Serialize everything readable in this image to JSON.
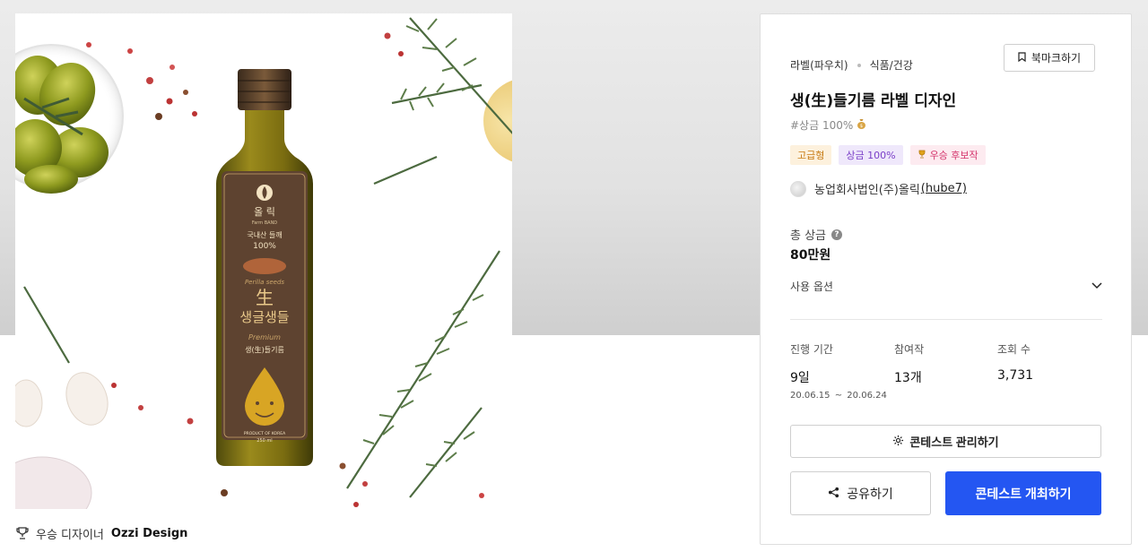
{
  "image": {
    "brand_korean": "올 릭",
    "brand_english": "Farm BAND",
    "label_line1": "국내산 들깨",
    "label_percent": "100%",
    "label_seeds": "Perilla seeds",
    "label_char": "生",
    "label_name": "생글생들",
    "label_premium": "Premium",
    "label_sub": "생(生)들기름",
    "label_product_of": "PRODUCT OF KOREA",
    "label_volume": "250 ml"
  },
  "winner": {
    "label": "우승 디자이너",
    "name": "Ozzi Design"
  },
  "contest": {
    "category": "라벨(파우치)",
    "subcategory": "식품/건강",
    "bookmark_label": "북마크하기",
    "title": "생(生)들기름 라벨 디자인",
    "hashtag": "#상금 100%",
    "tags": {
      "premium": "고급형",
      "prize": "상금 100%",
      "candidate": "우승 후보작"
    },
    "host_name": "농업회사법인(주)올릭",
    "host_handle": "(hube7)",
    "total_prize_label": "총 상금",
    "total_prize_value": "80만원",
    "usage_label": "사용 옵션",
    "stats": {
      "period_label": "진행 기간",
      "period_value": "9일",
      "period_start": "20.06.15",
      "period_sep": "~",
      "period_end": "20.06.24",
      "entries_label": "참여작",
      "entries_value": "13개",
      "views_label": "조회 수",
      "views_value": "3,731"
    },
    "manage_label": "콘테스트 관리하기",
    "share_label": "공유하기",
    "host_label": "콘테스트 개최하기"
  },
  "colors": {
    "accent": "#2456f2",
    "bottle_label": "#5e4330",
    "oil": "#8c7a12"
  }
}
